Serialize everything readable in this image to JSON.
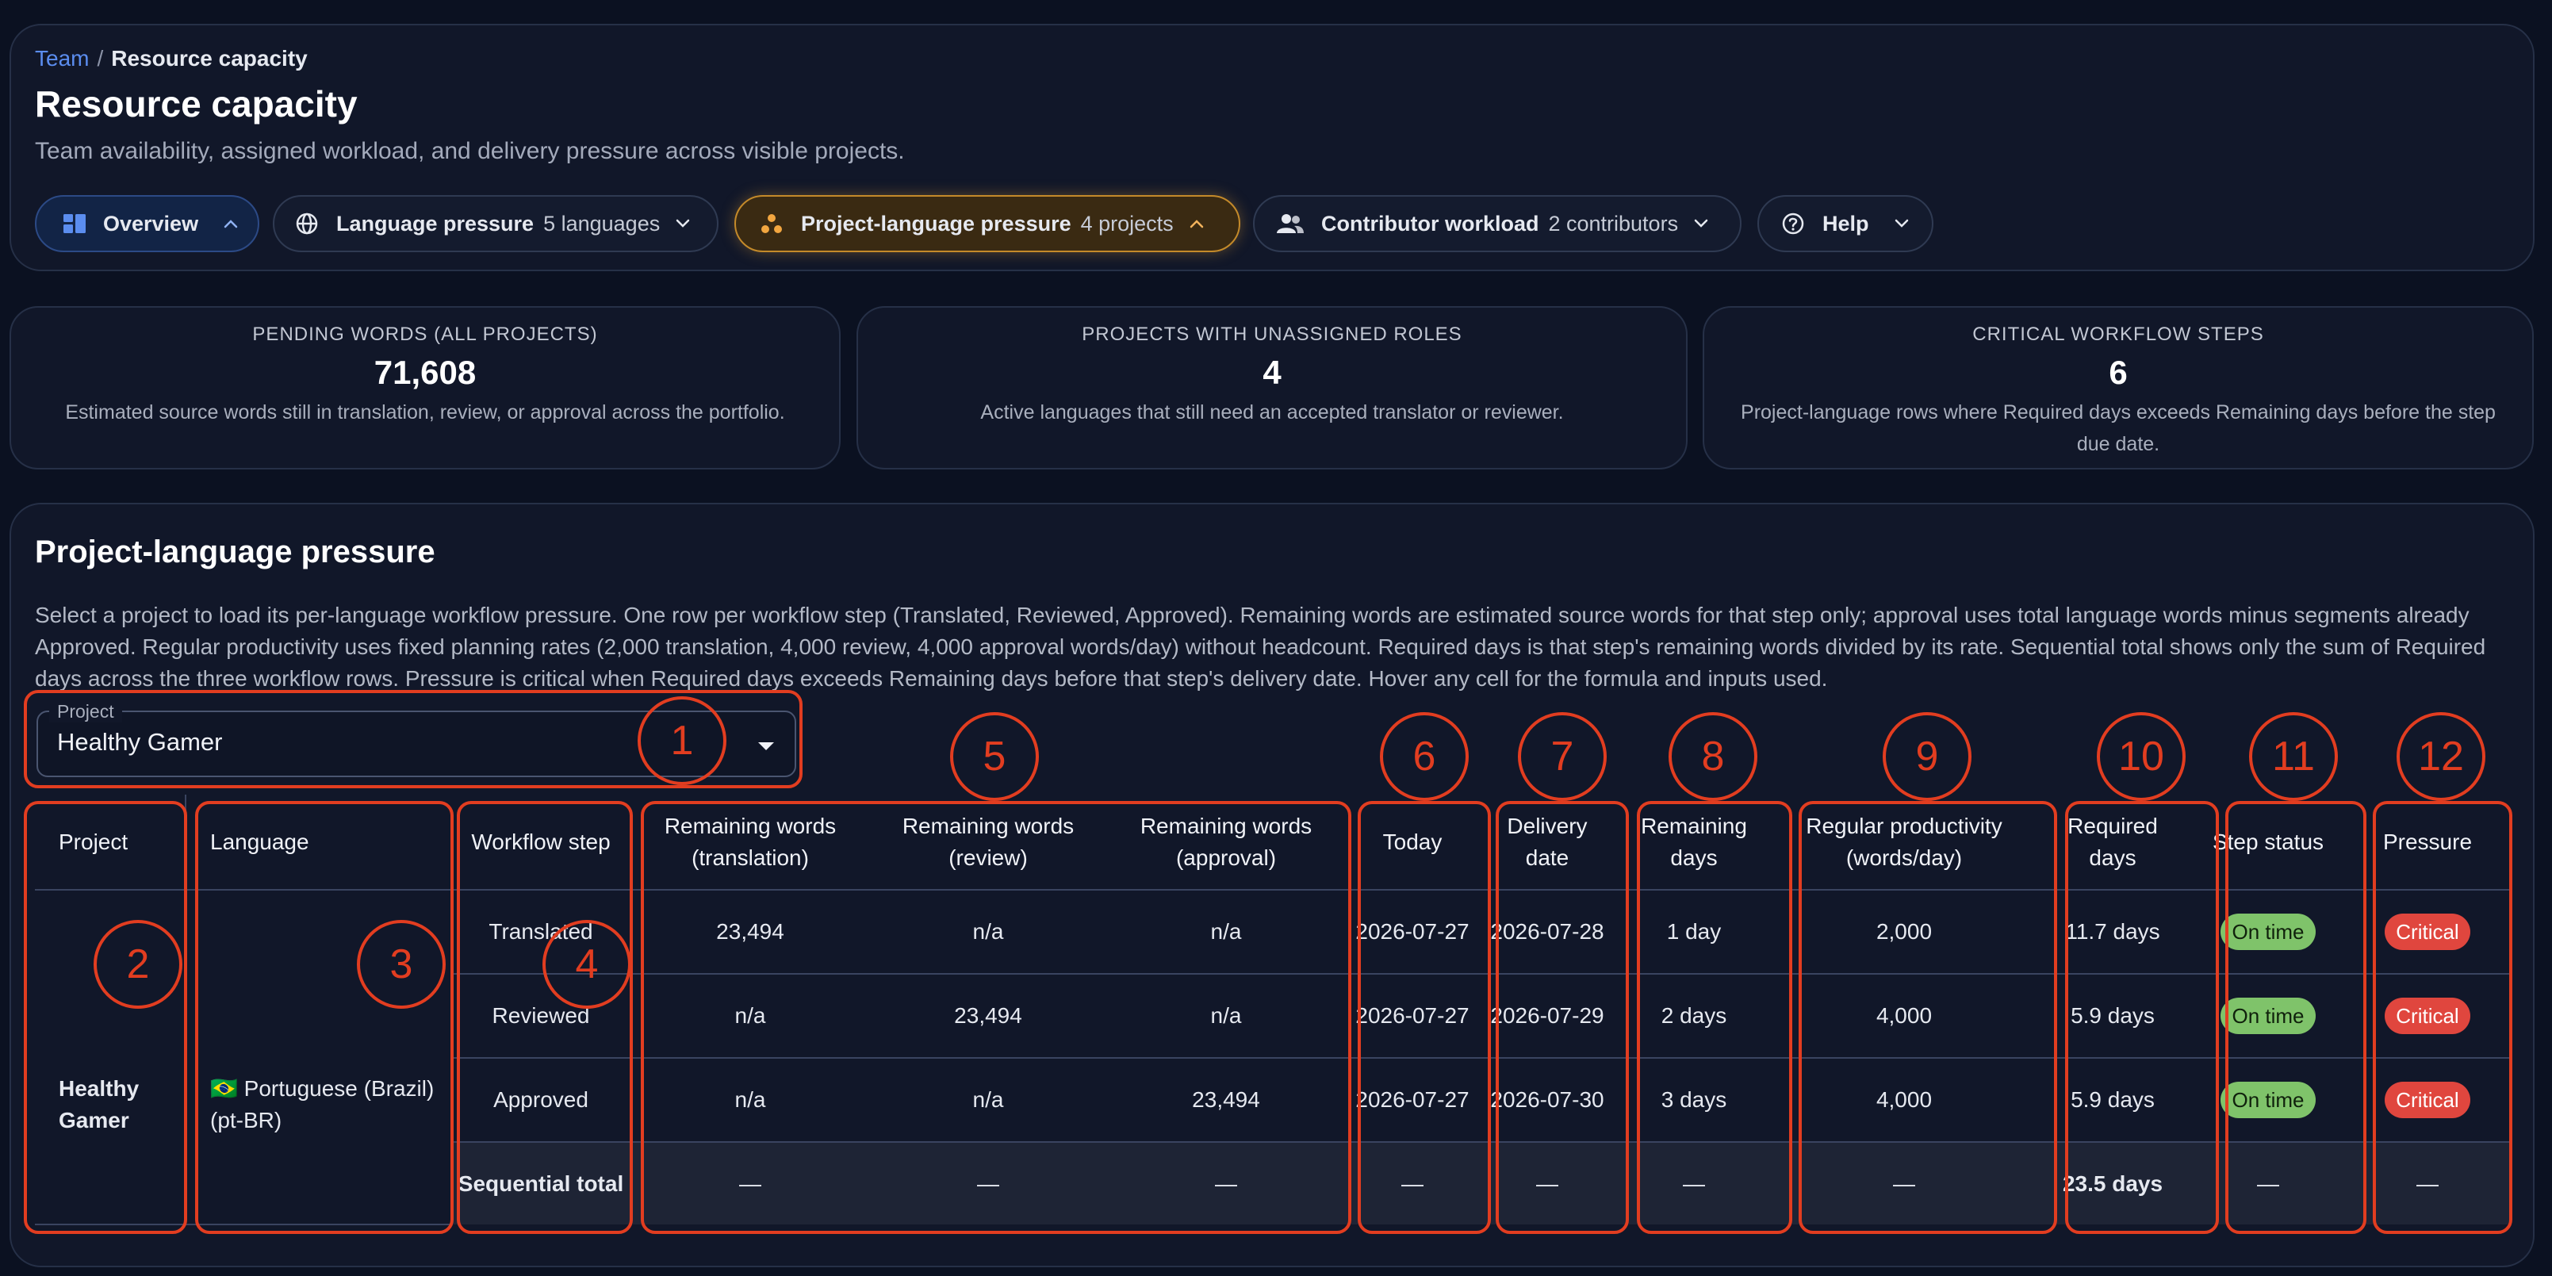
{
  "breadcrumb": {
    "parent": "Team",
    "separator": "/",
    "current": "Resource capacity"
  },
  "page": {
    "title": "Resource capacity",
    "subtitle": "Team availability, assigned workload, and delivery pressure across visible projects."
  },
  "tabs": [
    {
      "label": "Overview",
      "count": "",
      "icon": "dashboard-icon",
      "expanded": true
    },
    {
      "label": "Language pressure",
      "count": "5 languages",
      "icon": "globe-icon",
      "expanded": false
    },
    {
      "label": "Project-language pressure",
      "count": "4 projects",
      "icon": "dots-icon",
      "expanded": true
    },
    {
      "label": "Contributor workload",
      "count": "2 contributors",
      "icon": "users-icon",
      "expanded": false
    },
    {
      "label": "Help",
      "count": "",
      "icon": "help-icon",
      "expanded": false
    }
  ],
  "stats": [
    {
      "label": "Pending words (all projects)",
      "value": "71,608",
      "desc": "Estimated source words still in translation, review, or approval across the portfolio."
    },
    {
      "label": "Projects with unassigned roles",
      "value": "4",
      "desc": "Active languages that still need an accepted translator or reviewer."
    },
    {
      "label": "Critical workflow steps",
      "value": "6",
      "desc": "Project-language rows where Required days exceeds Remaining days before the step due date."
    }
  ],
  "section": {
    "title": "Project-language pressure",
    "description": "Select a project to load its per-language workflow pressure. One row per workflow step (Translated, Reviewed, Approved). Remaining words are estimated source words for that step only; approval uses total language words minus segments already Approved. Regular productivity uses fixed planning rates (2,000 translation, 4,000 review, 4,000 approval words/day) without headcount. Required days is that step's remaining words divided by its rate. Sequential total shows only the sum of Required days across the three workflow rows. Pressure is critical when Required days exceeds Remaining days before that step's delivery date. Hover any cell for the formula and inputs used."
  },
  "project_select": {
    "label": "Project",
    "value": "Healthy Gamer"
  },
  "table": {
    "headers": [
      "Project",
      "Language",
      "Workflow step",
      "Remaining words (translation)",
      "Remaining words (review)",
      "Remaining words (approval)",
      "Today",
      "Delivery date",
      "Remaining days",
      "Regular productivity (words/day)",
      "Required days",
      "Step status",
      "Pressure"
    ],
    "project": "Healthy Gamer",
    "language_flag": "🇧🇷",
    "language": "Portuguese (Brazil) (pt-BR)",
    "rows": [
      {
        "step": "Translated",
        "rw_translation": "23,494",
        "rw_review": "n/a",
        "rw_approval": "n/a",
        "today": "2026-07-27",
        "delivery": "2026-07-28",
        "remaining_days": "1 day",
        "productivity": "2,000",
        "required_days": "11.7 days",
        "status": "On time",
        "pressure": "Critical"
      },
      {
        "step": "Reviewed",
        "rw_translation": "n/a",
        "rw_review": "23,494",
        "rw_approval": "n/a",
        "today": "2026-07-27",
        "delivery": "2026-07-29",
        "remaining_days": "2 days",
        "productivity": "4,000",
        "required_days": "5.9 days",
        "status": "On time",
        "pressure": "Critical"
      },
      {
        "step": "Approved",
        "rw_translation": "n/a",
        "rw_review": "n/a",
        "rw_approval": "23,494",
        "today": "2026-07-27",
        "delivery": "2026-07-30",
        "remaining_days": "3 days",
        "productivity": "4,000",
        "required_days": "5.9 days",
        "status": "On time",
        "pressure": "Critical"
      }
    ],
    "total": {
      "label": "Sequential total",
      "dash": "—",
      "required_days": "23.5 days"
    }
  },
  "annotations": [
    "1",
    "2",
    "3",
    "4",
    "5",
    "6",
    "7",
    "8",
    "9",
    "10",
    "11",
    "12"
  ],
  "colors": {
    "background": "#0b1121",
    "panel": "#111729",
    "link": "#5b8def",
    "active_tab": "#c48a2a",
    "on_time": "#7fc36a",
    "critical": "#e0463e",
    "annotation": "#e23d20"
  }
}
